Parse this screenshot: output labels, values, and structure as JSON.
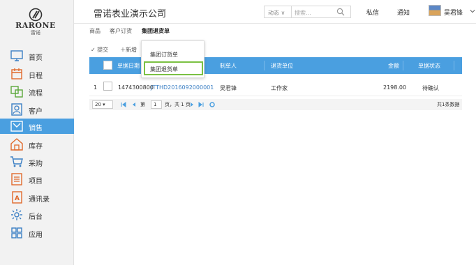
{
  "logo": {
    "brand": "RARONE",
    "brand_cn": "雷诺"
  },
  "sidebar": {
    "items": [
      {
        "label": "首页",
        "icon": "monitor-icon"
      },
      {
        "label": "日程",
        "icon": "calendar-icon"
      },
      {
        "label": "流程",
        "icon": "flow-icon"
      },
      {
        "label": "客户",
        "icon": "customer-icon"
      },
      {
        "label": "销售",
        "icon": "sales-icon",
        "active": true
      },
      {
        "label": "库存",
        "icon": "warehouse-icon"
      },
      {
        "label": "采购",
        "icon": "cart-icon"
      },
      {
        "label": "项目",
        "icon": "project-icon"
      },
      {
        "label": "通讯录",
        "icon": "contacts-icon"
      },
      {
        "label": "后台",
        "icon": "gear-icon"
      },
      {
        "label": "应用",
        "icon": "apps-icon"
      }
    ]
  },
  "header": {
    "company": "雷诺表业演示公司",
    "dynamic_label": "动态",
    "search_placeholder": "搜索...",
    "private_msg": "私信",
    "notify": "通知",
    "username": "吴君锋"
  },
  "tabs": [
    "商品",
    "客户订货",
    "集团退货单"
  ],
  "toolbar": {
    "submit": "提交",
    "add": "新增"
  },
  "table": {
    "columns": [
      "单据日期",
      "制单人",
      "退货单位",
      "金额",
      "单据状态"
    ],
    "rows": [
      {
        "index": "1",
        "date": "1474300800",
        "code": "JTTHD2016092000001",
        "maker": "吴君锋",
        "unit": "工作家",
        "amount": "2198.00",
        "status": "待确认"
      }
    ]
  },
  "pager": {
    "page_size": "20",
    "page_label": "第",
    "page_value": "1",
    "page_suffix": "页，共 1 页",
    "total": "共1条数据"
  },
  "dropdown": {
    "items": [
      "集团订货单",
      "集团退货单"
    ]
  },
  "colors": {
    "accent": "#4a9fe0",
    "highlight": "#7bc143",
    "link": "#3b7fc4"
  }
}
